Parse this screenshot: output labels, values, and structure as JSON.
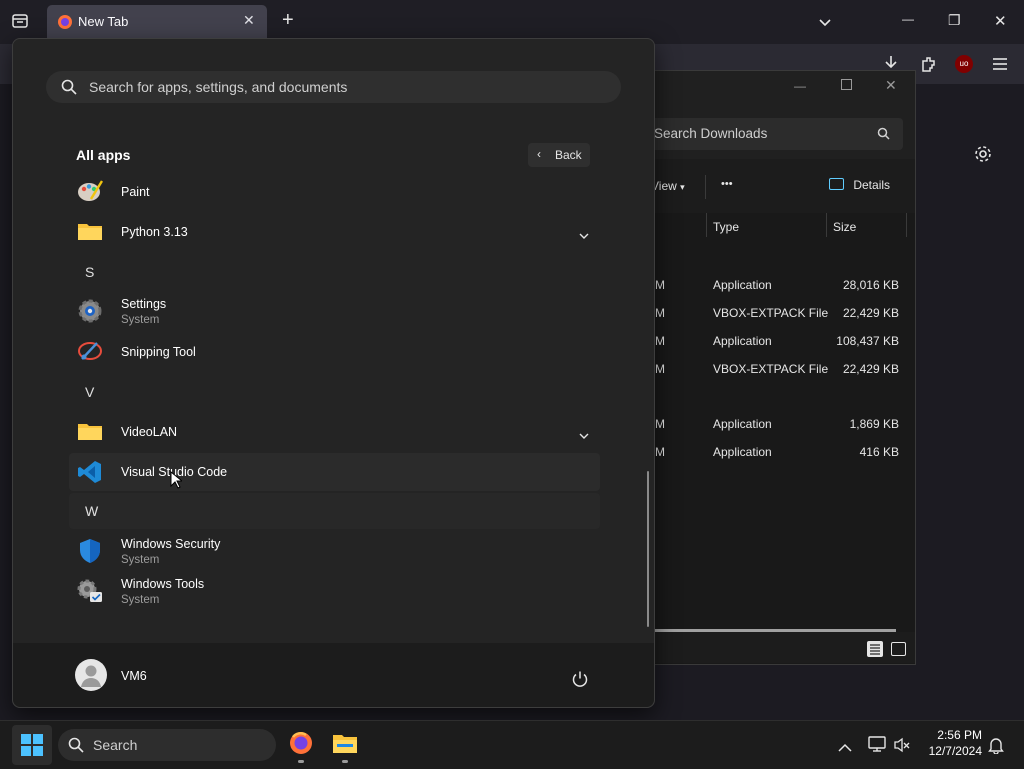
{
  "browser": {
    "tab_title": "New Tab",
    "new_tab_symbol": "+",
    "close_tab_symbol": "✕",
    "extension_badge": "uo"
  },
  "window_controls": {
    "minimize": "—",
    "restore": "❐",
    "close": "✕"
  },
  "explorer": {
    "search_placeholder": "Search Downloads",
    "view_label": "View",
    "more_label": "•••",
    "details_label": "Details",
    "columns": {
      "type": "Type",
      "size": "Size"
    },
    "rows": [
      {
        "date_tail": "M",
        "type": "Application",
        "size": "28,016 KB"
      },
      {
        "date_tail": "M",
        "type": "VBOX-EXTPACK File",
        "size": "22,429 KB"
      },
      {
        "date_tail": "M",
        "type": "Application",
        "size": "108,437 KB"
      },
      {
        "date_tail": "M",
        "type": "VBOX-EXTPACK File",
        "size": "22,429 KB"
      },
      {
        "date_tail": "M",
        "type": "Application",
        "size": "1,869 KB"
      },
      {
        "date_tail": "M",
        "type": "Application",
        "size": "416 KB"
      }
    ]
  },
  "start_menu": {
    "search_placeholder": "Search for apps, settings, and documents",
    "all_apps_title": "All apps",
    "back_label": "Back",
    "apps": {
      "paint": {
        "name": "Paint"
      },
      "python": {
        "name": "Python 3.13"
      },
      "letter_s": "S",
      "settings": {
        "name": "Settings",
        "sub": "System"
      },
      "snipping": {
        "name": "Snipping Tool"
      },
      "letter_v": "V",
      "videolan": {
        "name": "VideoLAN"
      },
      "vscode": {
        "name": "Visual Studio Code"
      },
      "letter_w": "W",
      "winsec": {
        "name": "Windows Security",
        "sub": "System"
      },
      "wintools": {
        "name": "Windows Tools",
        "sub": "System"
      }
    },
    "user_name": "VM6"
  },
  "taskbar": {
    "search_label": "Search",
    "time": "2:56 PM",
    "date": "12/7/2024"
  },
  "colors": {
    "accent": "#0078d4",
    "folder": "#f8c33c",
    "firefox_tab_bg": "#42414d"
  }
}
